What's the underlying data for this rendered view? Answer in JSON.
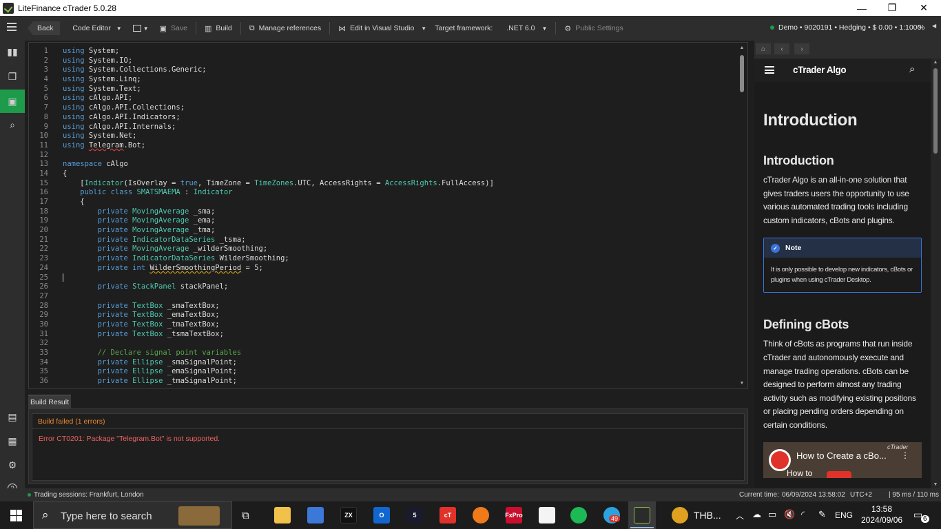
{
  "window": {
    "title": "LiteFinance cTrader 5.0.28",
    "minimize": "—",
    "restore": "❐",
    "close": "✕"
  },
  "toolbar": {
    "back": "Back",
    "code_editor": "Code Editor",
    "save": "Save",
    "build": "Build",
    "manage_references": "Manage references",
    "edit_vs": "Edit in Visual Studio",
    "target_framework_label": "Target framework:",
    "target_framework_value": ".NET 6.0",
    "public_settings": "Public Settings",
    "account": "Demo • 9020191 • Hedging • $ 0.00 • 1:1000",
    "percent": "%"
  },
  "editor": {
    "line_numbers": [
      "1",
      "2",
      "3",
      "4",
      "5",
      "6",
      "7",
      "8",
      "9",
      "10",
      "11",
      "12",
      "13",
      "14",
      "15",
      "16",
      "17",
      "18",
      "19",
      "20",
      "21",
      "22",
      "23",
      "24",
      "25",
      "26",
      "27",
      "28",
      "29",
      "30",
      "31",
      "32",
      "33",
      "34",
      "35",
      "36"
    ],
    "lines": [
      [
        {
          "t": "using",
          "c": "kw"
        },
        {
          "t": " System;"
        }
      ],
      [
        {
          "t": "using",
          "c": "kw"
        },
        {
          "t": " System.IO;"
        }
      ],
      [
        {
          "t": "using",
          "c": "kw"
        },
        {
          "t": " System.Collections.Generic;"
        }
      ],
      [
        {
          "t": "using",
          "c": "kw"
        },
        {
          "t": " System.Linq;"
        }
      ],
      [
        {
          "t": "using",
          "c": "kw"
        },
        {
          "t": " System.Text;"
        }
      ],
      [
        {
          "t": "using",
          "c": "kw"
        },
        {
          "t": " cAlgo.API;"
        }
      ],
      [
        {
          "t": "using",
          "c": "kw"
        },
        {
          "t": " cAlgo.API.Collections;"
        }
      ],
      [
        {
          "t": "using",
          "c": "kw"
        },
        {
          "t": " cAlgo.API.Indicators;"
        }
      ],
      [
        {
          "t": "using",
          "c": "kw"
        },
        {
          "t": " cAlgo.API.Internals;"
        }
      ],
      [
        {
          "t": "using",
          "c": "kw"
        },
        {
          "t": " System.Net;"
        }
      ],
      [
        {
          "t": "using",
          "c": "kw"
        },
        {
          "t": " "
        },
        {
          "t": "Telegram",
          "c": "sqr"
        },
        {
          "t": ".Bot;"
        }
      ],
      [],
      [
        {
          "t": "namespace",
          "c": "kw"
        },
        {
          "t": " cAlgo"
        }
      ],
      [
        {
          "t": "{"
        }
      ],
      [
        {
          "t": "    ["
        },
        {
          "t": "Indicator",
          "c": "ty"
        },
        {
          "t": "(IsOverlay = "
        },
        {
          "t": "true",
          "c": "kw"
        },
        {
          "t": ", TimeZone = "
        },
        {
          "t": "TimeZones",
          "c": "ty"
        },
        {
          "t": ".UTC, AccessRights = "
        },
        {
          "t": "AccessRights",
          "c": "ty"
        },
        {
          "t": ".FullAccess)]"
        }
      ],
      [
        {
          "t": "    "
        },
        {
          "t": "public",
          "c": "kw"
        },
        {
          "t": " "
        },
        {
          "t": "class",
          "c": "kw"
        },
        {
          "t": " "
        },
        {
          "t": "SMATSMAEMA",
          "c": "ty"
        },
        {
          "t": " : "
        },
        {
          "t": "Indicator",
          "c": "ty"
        }
      ],
      [
        {
          "t": "    {"
        }
      ],
      [
        {
          "t": "        "
        },
        {
          "t": "private",
          "c": "kw"
        },
        {
          "t": " "
        },
        {
          "t": "MovingAverage",
          "c": "ty"
        },
        {
          "t": " _sma;"
        }
      ],
      [
        {
          "t": "        "
        },
        {
          "t": "private",
          "c": "kw"
        },
        {
          "t": " "
        },
        {
          "t": "MovingAverage",
          "c": "ty"
        },
        {
          "t": " _ema;"
        }
      ],
      [
        {
          "t": "        "
        },
        {
          "t": "private",
          "c": "kw"
        },
        {
          "t": " "
        },
        {
          "t": "MovingAverage",
          "c": "ty"
        },
        {
          "t": " _tma;"
        }
      ],
      [
        {
          "t": "        "
        },
        {
          "t": "private",
          "c": "kw"
        },
        {
          "t": " "
        },
        {
          "t": "IndicatorDataSeries",
          "c": "ty"
        },
        {
          "t": " _tsma;"
        }
      ],
      [
        {
          "t": "        "
        },
        {
          "t": "private",
          "c": "kw"
        },
        {
          "t": " "
        },
        {
          "t": "MovingAverage",
          "c": "ty"
        },
        {
          "t": " _wilderSmoothing;"
        }
      ],
      [
        {
          "t": "        "
        },
        {
          "t": "private",
          "c": "kw"
        },
        {
          "t": " "
        },
        {
          "t": "IndicatorDataSeries",
          "c": "ty"
        },
        {
          "t": " WilderSmoothing;"
        }
      ],
      [
        {
          "t": "        "
        },
        {
          "t": "private",
          "c": "kw"
        },
        {
          "t": " "
        },
        {
          "t": "int",
          "c": "kw"
        },
        {
          "t": " "
        },
        {
          "t": "WilderSmoothingPeriod",
          "c": "sq"
        },
        {
          "t": " = 5;"
        }
      ],
      [],
      [
        {
          "t": "        "
        },
        {
          "t": "private",
          "c": "kw"
        },
        {
          "t": " "
        },
        {
          "t": "StackPanel",
          "c": "ty"
        },
        {
          "t": " stackPanel;"
        }
      ],
      [],
      [
        {
          "t": "        "
        },
        {
          "t": "private",
          "c": "kw"
        },
        {
          "t": " "
        },
        {
          "t": "TextBox",
          "c": "ty"
        },
        {
          "t": " _smaTextBox;"
        }
      ],
      [
        {
          "t": "        "
        },
        {
          "t": "private",
          "c": "kw"
        },
        {
          "t": " "
        },
        {
          "t": "TextBox",
          "c": "ty"
        },
        {
          "t": " _emaTextBox;"
        }
      ],
      [
        {
          "t": "        "
        },
        {
          "t": "private",
          "c": "kw"
        },
        {
          "t": " "
        },
        {
          "t": "TextBox",
          "c": "ty"
        },
        {
          "t": " _tmaTextBox;"
        }
      ],
      [
        {
          "t": "        "
        },
        {
          "t": "private",
          "c": "kw"
        },
        {
          "t": " "
        },
        {
          "t": "TextBox",
          "c": "ty"
        },
        {
          "t": " _tsmaTextBox;"
        }
      ],
      [],
      [
        {
          "t": "        "
        },
        {
          "t": "// Declare signal point variables",
          "c": "cm"
        }
      ],
      [
        {
          "t": "        "
        },
        {
          "t": "private",
          "c": "kw"
        },
        {
          "t": " "
        },
        {
          "t": "Ellipse",
          "c": "ty"
        },
        {
          "t": " _smaSignalPoint;"
        }
      ],
      [
        {
          "t": "        "
        },
        {
          "t": "private",
          "c": "kw"
        },
        {
          "t": " "
        },
        {
          "t": "Ellipse",
          "c": "ty"
        },
        {
          "t": " _emaSignalPoint;"
        }
      ],
      [
        {
          "t": "        "
        },
        {
          "t": "private",
          "c": "kw"
        },
        {
          "t": " "
        },
        {
          "t": "Ellipse",
          "c": "ty"
        },
        {
          "t": " _tmaSignalPoint;"
        }
      ]
    ]
  },
  "build": {
    "tab_label": "Build Result",
    "status": "Build failed (1 errors)",
    "error": "Error CT0201: Package \"Telegram.Bot\" is not supported."
  },
  "docs": {
    "header_title": "cTrader Algo",
    "page_title": "Introduction",
    "section1_title": "Introduction",
    "section1_text": "cTrader Algo is an all-in-one solution that gives traders users the opportunity to use various automated trading tools including custom indicators, cBots and plugins.",
    "note_title": "Note",
    "note_text": "It is only possible to develop new indicators, cBots or plugins when using cTrader Desktop.",
    "section2_title": "Defining cBots",
    "section2_text": "Think of cBots as programs that run inside cTrader and autonomously execute and manage trading operations. cBots can be designed to perform almost any trading activity such as modifying existing positions or placing pending orders depending on certain conditions.",
    "video_title": "How to Create a cBo...",
    "video_watermark": "cTrader",
    "video_subtitle": "How to"
  },
  "status": {
    "sessions": "Trading sessions: Frankfurt, London",
    "current_time_label": "Current time:",
    "current_time": "06/09/2024 13:58:02",
    "utc": "UTC+2",
    "latency": "| 95 ms / 110 ms"
  },
  "taskbar": {
    "search_placeholder": "Type here to search",
    "pinned_app": "THB...",
    "badge_telegram": "49",
    "lang": "ENG",
    "time": "13:58",
    "date": "2024/09/06",
    "notifications": "6"
  },
  "colors": {
    "accent": "#1e9a4b",
    "error": "#f06262",
    "warning": "#e8872c",
    "note_border": "#3b73d8"
  }
}
